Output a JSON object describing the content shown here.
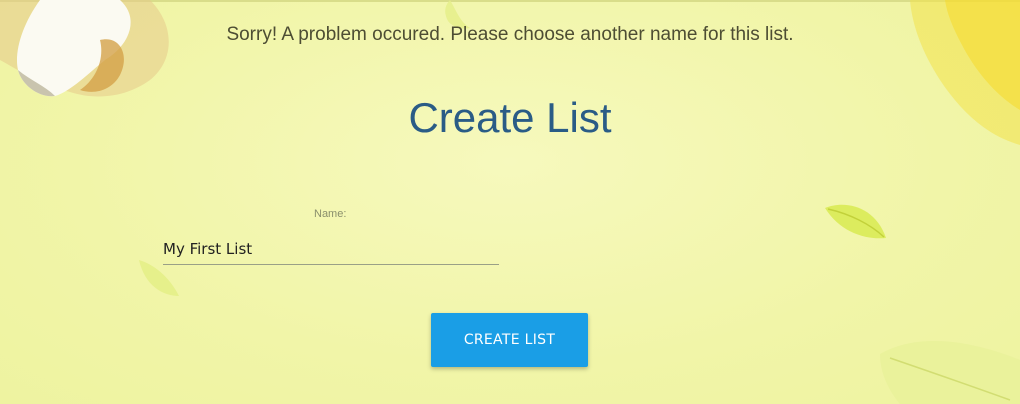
{
  "alert": {
    "message": "Sorry! A problem occured. Please choose another name for this list."
  },
  "page": {
    "title": "Create List"
  },
  "form": {
    "name_label": "Name:",
    "name_value": "My First List"
  },
  "actions": {
    "create_label": "CREATE LIST"
  },
  "colors": {
    "background": "#f4f8b3",
    "title": "#2a5c86",
    "button": "#1a9ee6",
    "button_text": "#ffffff"
  }
}
